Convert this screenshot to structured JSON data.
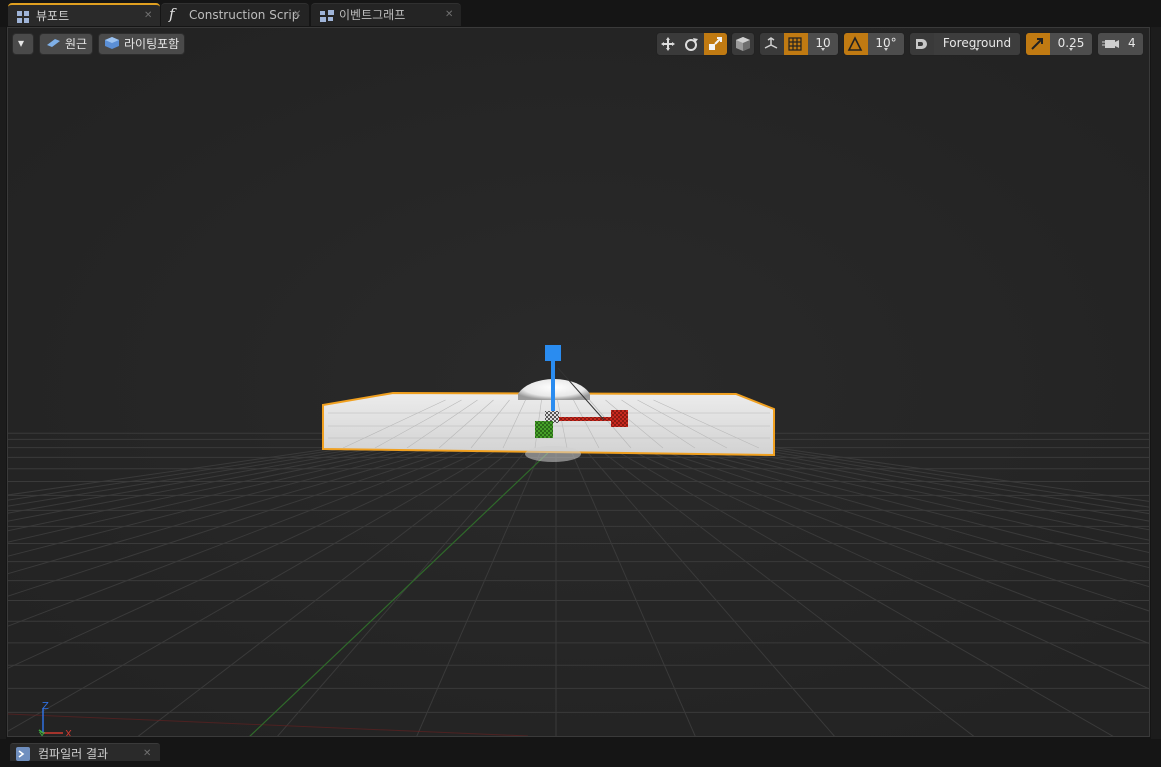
{
  "tabs": [
    {
      "label": "뷰포트",
      "icon": "viewport-icon",
      "active": true
    },
    {
      "label": "Construction Scrip",
      "icon": "function-icon",
      "active": false
    },
    {
      "label": "이벤트그래프",
      "icon": "graph-icon",
      "active": false
    }
  ],
  "toolbar_left": {
    "perspective_label": "원근",
    "lit_label": "라이팅포함"
  },
  "toolbar_right": {
    "grid_snap_value": "10",
    "rotation_snap_value": "10°",
    "layer_value": "Foreground",
    "scale_snap_value": "0.25",
    "camera_speed_value": "4"
  },
  "axis_indicator": {
    "z": "Z",
    "y": "Y",
    "x": "X"
  },
  "bottom_tab": {
    "label": "컴파일러 결과",
    "icon": "output-log-icon"
  },
  "colors": {
    "accent": "#e0a020",
    "active_toggle": "#c07a12",
    "viewport_bg": "#262626",
    "gizmo_x": "#c8281e",
    "gizmo_y": "#46a028",
    "gizmo_z": "#2a8cf0"
  }
}
